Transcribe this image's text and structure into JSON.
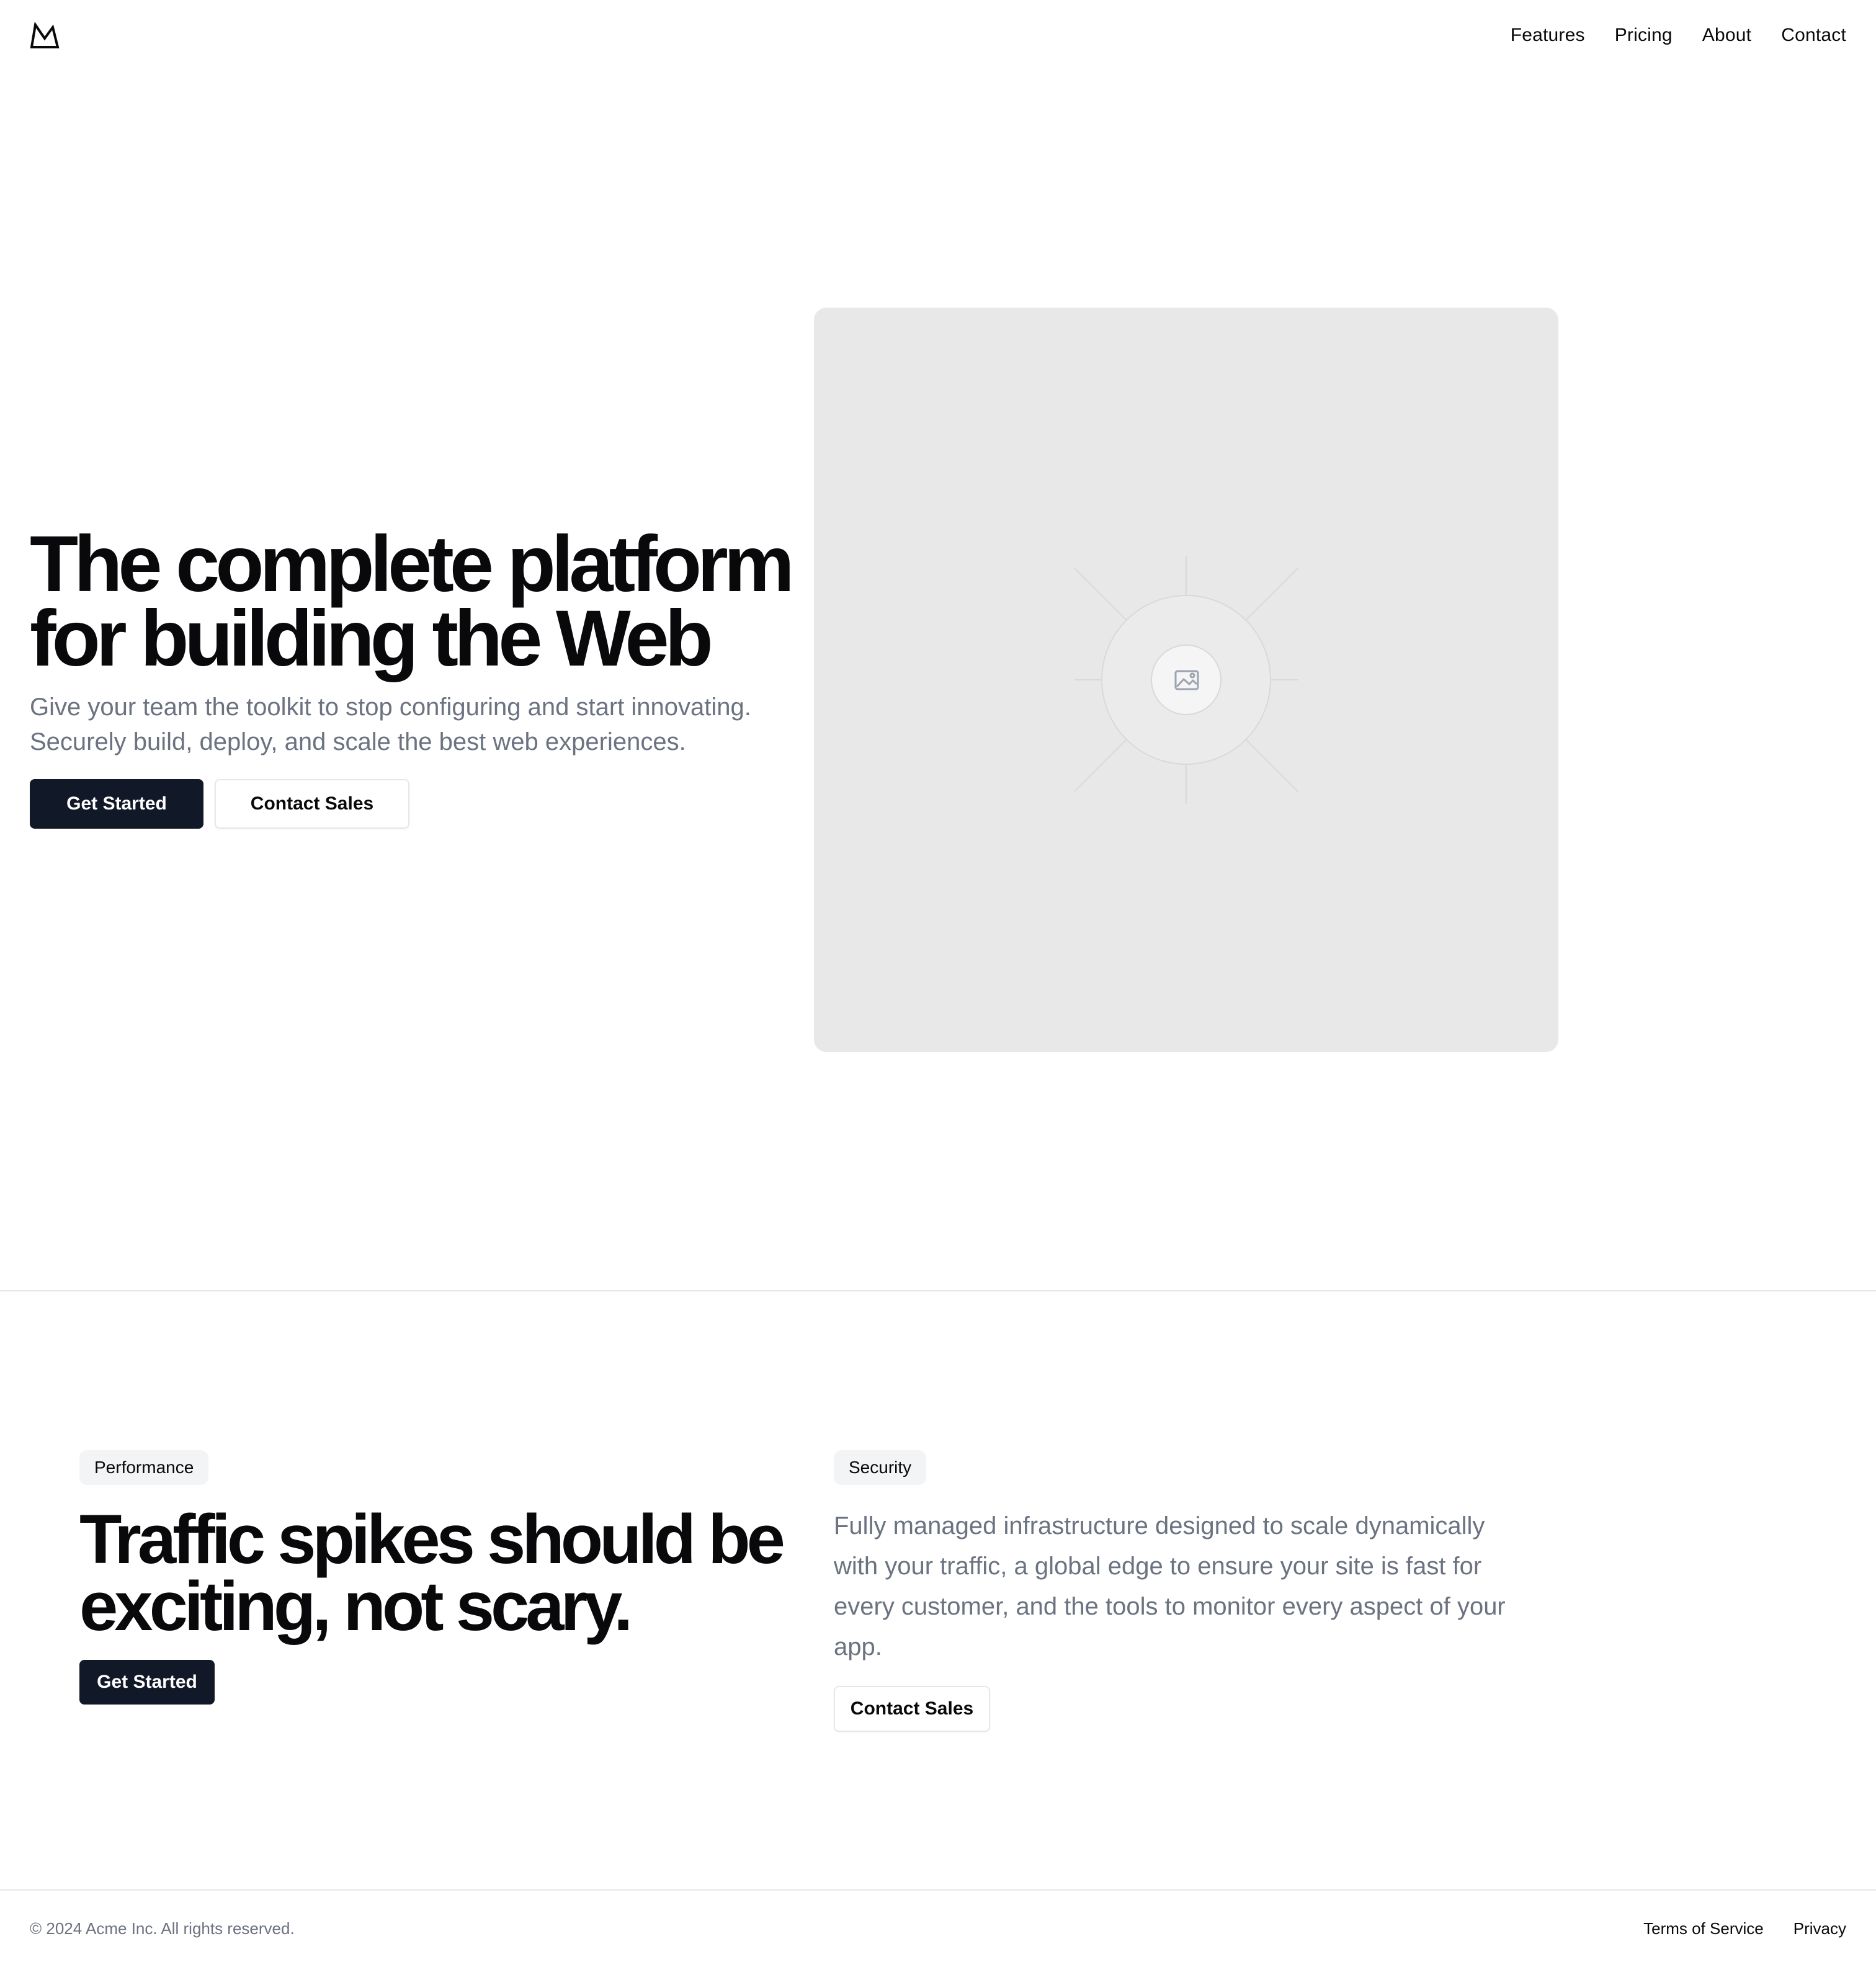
{
  "header": {
    "logo_icon": "mountain-logo-icon",
    "nav": [
      {
        "label": "Features"
      },
      {
        "label": "Pricing"
      },
      {
        "label": "About"
      },
      {
        "label": "Contact"
      }
    ]
  },
  "hero": {
    "title": "The complete platform for building the Web",
    "subtitle": "Give your team the toolkit to stop configuring and start innovating. Securely build, deploy, and scale the best web experiences.",
    "primary_cta": "Get Started",
    "secondary_cta": "Contact Sales",
    "image_icon": "image-placeholder-icon"
  },
  "feature": {
    "badge_left": "Performance",
    "title": "Traffic spikes should be exciting, not scary.",
    "primary_cta": "Get Started",
    "badge_right": "Security",
    "description": "Fully managed infrastructure designed to scale dynamically with your traffic, a global edge to ensure your site is fast for every customer, and the tools to monitor every aspect of your app.",
    "secondary_cta": "Contact Sales"
  },
  "footer": {
    "copyright": "© 2024 Acme Inc. All rights reserved.",
    "links": [
      {
        "label": "Terms of Service"
      },
      {
        "label": "Privacy"
      }
    ]
  },
  "colors": {
    "primary_button": "#111827",
    "muted_text": "#6b7280",
    "placeholder_bg": "#e8e8e8",
    "border": "#e5e7eb"
  }
}
